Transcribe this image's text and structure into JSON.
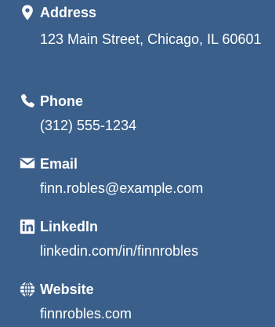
{
  "accent_color": "#ffffff",
  "background_color": "#3a5f8a",
  "contacts": [
    {
      "icon": "map-marker-icon",
      "label": "Address",
      "value": "123 Main Street, Chicago, IL 60601"
    },
    {
      "icon": "phone-icon",
      "label": "Phone",
      "value": "(312) 555-1234"
    },
    {
      "icon": "envelope-icon",
      "label": "Email",
      "value": "finn.robles@example.com"
    },
    {
      "icon": "linkedin-icon",
      "label": "LinkedIn",
      "value": "linkedin.com/in/finnrobles"
    },
    {
      "icon": "globe-icon",
      "label": "Website",
      "value": "finnrobles.com"
    }
  ]
}
